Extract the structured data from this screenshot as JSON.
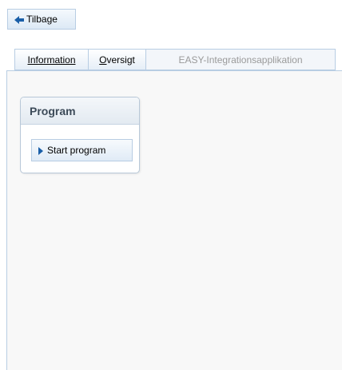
{
  "toolbar": {
    "back_label": "Tilbage",
    "back_icon": "arrow-left-icon"
  },
  "tabs": [
    {
      "label": "Information",
      "underline": "I",
      "rest": "nformation",
      "enabled": true
    },
    {
      "label": "Oversigt",
      "underline": "O",
      "rest": "versigt",
      "enabled": true
    },
    {
      "label": "EASY-Integrationsapplikation",
      "enabled": false
    }
  ],
  "panel": {
    "title": "Program",
    "start_label": "Start program",
    "start_icon": "play-triangle-icon"
  },
  "colors": {
    "border": "#b8cde3",
    "icon_blue": "#1a5fa8",
    "disabled_text": "#9a9a9a",
    "panel_title": "#3c4a58"
  }
}
